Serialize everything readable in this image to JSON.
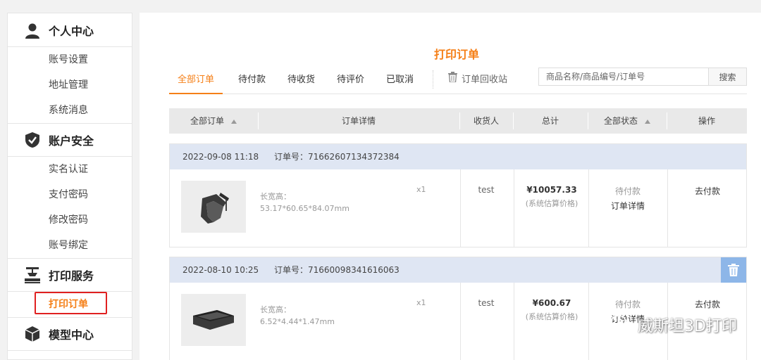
{
  "sidebar": {
    "sections": [
      {
        "title": "个人中心",
        "icon": "user-icon",
        "items": [
          "账号设置",
          "地址管理",
          "系统消息"
        ]
      },
      {
        "title": "账户安全",
        "icon": "shield-icon",
        "items": [
          "实名认证",
          "支付密码",
          "修改密码",
          "账号绑定"
        ]
      },
      {
        "title": "打印服务",
        "icon": "printer-icon",
        "items": [
          "打印订单"
        ]
      },
      {
        "title": "模型中心",
        "icon": "cube-icon",
        "items": []
      }
    ],
    "active_item": "打印订单"
  },
  "main": {
    "title": "打印订单",
    "tabs": [
      "全部订单",
      "待付款",
      "待收货",
      "待评价",
      "已取消"
    ],
    "recycle_label": "订单回收站",
    "search_placeholder": "商品名称/商品编号/订单号",
    "search_button": "搜索",
    "table_headers": [
      "全部订单",
      "订单详情",
      "收货人",
      "总计",
      "全部状态",
      "操作"
    ],
    "orders": [
      {
        "time": "2022-09-08 11:18",
        "order_no": "订单号：71662607134372384",
        "dims_label": "长宽高：",
        "dims": "53.17*60.65*84.07mm",
        "qty": "x1",
        "receiver": "test",
        "price": "¥10057.33",
        "price_note": "(系统估算价格)",
        "status": "待付款",
        "detail_link": "订单详情",
        "action": "去付款"
      },
      {
        "time": "2022-08-10 10:25",
        "order_no": "订单号：71660098341616063",
        "dims_label": "长宽高：",
        "dims": "6.52*4.44*1.47mm",
        "qty": "x1",
        "receiver": "test",
        "price": "¥600.67",
        "price_note": "(系统估算价格)",
        "status": "待付款",
        "detail_link": "订单详情",
        "action": "去付款"
      }
    ]
  },
  "watermark": "威斯坦3D打印",
  "colors": {
    "accent": "#f57f17",
    "highlight_box": "#e02020",
    "order_head": "#dfe6f3",
    "trash_btn": "#8db6e8"
  }
}
